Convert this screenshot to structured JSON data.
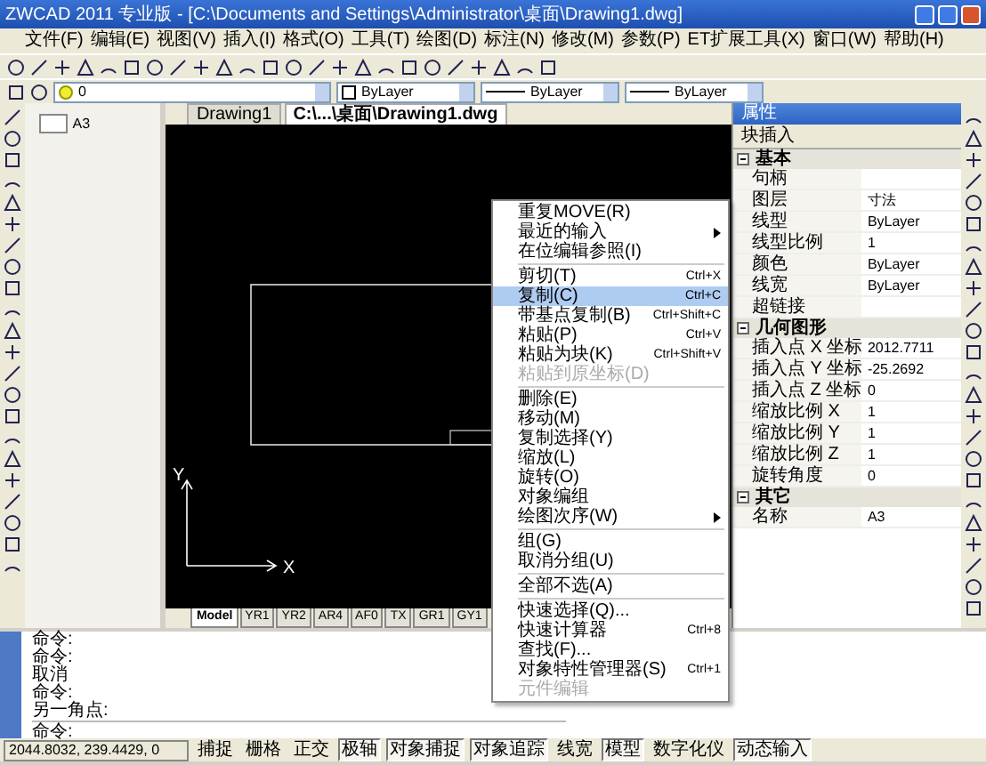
{
  "window": {
    "title": "ZWCAD 2011 专业版 - [C:\\Documents and Settings\\Administrator\\桌面\\Drawing1.dwg]"
  },
  "menu": [
    {
      "label": "文件(F)"
    },
    {
      "label": "编辑(E)"
    },
    {
      "label": "视图(V)"
    },
    {
      "label": "插入(I)"
    },
    {
      "label": "格式(O)"
    },
    {
      "label": "工具(T)"
    },
    {
      "label": "绘图(D)"
    },
    {
      "label": "标注(N)"
    },
    {
      "label": "修改(M)"
    },
    {
      "label": "参数(P)"
    },
    {
      "label": "ET扩展工具(X)"
    },
    {
      "label": "窗口(W)"
    },
    {
      "label": "帮助(H)"
    }
  ],
  "toolbar": {
    "layer": "0",
    "combos": [
      {
        "kind": "swatch",
        "value": "ByLayer"
      },
      {
        "kind": "line",
        "value": "ByLayer"
      },
      {
        "kind": "line",
        "value": "ByLayer"
      }
    ]
  },
  "block_preview": {
    "label": "A3"
  },
  "doc_tabs": [
    {
      "label": "Drawing1",
      "selected": false
    },
    {
      "label": "C:\\...\\桌面\\Drawing1.dwg",
      "selected": true
    }
  ],
  "canvas": {
    "x_axis": "X",
    "y_axis": "Y"
  },
  "layout_tabs": [
    {
      "label": "Model",
      "selected": true
    },
    {
      "label": "YR1",
      "selected": false
    },
    {
      "label": "YR2",
      "selected": false
    },
    {
      "label": "AR4",
      "selected": false
    },
    {
      "label": "AF0",
      "selected": false
    },
    {
      "label": "TX",
      "selected": false
    },
    {
      "label": "GR1",
      "selected": false
    },
    {
      "label": "GY1",
      "selected": false
    }
  ],
  "properties": {
    "title": "属性",
    "object": "块插入",
    "sections": [
      {
        "name": "基本",
        "expanded": true,
        "rows": [
          {
            "label": "句柄"
          },
          {
            "label": "图层",
            "value": "寸法"
          },
          {
            "label": "线型",
            "value": "ByLayer"
          },
          {
            "label": "线型比例",
            "value": "1"
          },
          {
            "label": "颜色",
            "value": "ByLayer"
          },
          {
            "label": "线宽",
            "value": "ByLayer"
          },
          {
            "label": "超链接"
          }
        ]
      },
      {
        "name": "几何图形",
        "expanded": true,
        "rows": [
          {
            "label": "插入点 X 坐标",
            "value": "2012.7711"
          },
          {
            "label": "插入点 Y 坐标",
            "value": "-25.2692"
          },
          {
            "label": "插入点 Z 坐标",
            "value": "0"
          },
          {
            "label": "缩放比例 X",
            "value": "1"
          },
          {
            "label": "缩放比例 Y",
            "value": "1"
          },
          {
            "label": "缩放比例 Z",
            "value": "1"
          },
          {
            "label": "旋转角度",
            "value": "0"
          }
        ]
      },
      {
        "name": "其它",
        "expanded": true,
        "rows": [
          {
            "label": "名称",
            "value": "A3"
          }
        ]
      }
    ]
  },
  "context_menu": [
    {
      "kind": "item",
      "label": "重复MOVE(R)",
      "selected": false,
      "disabled": false
    },
    {
      "kind": "item",
      "label": "最近的输入",
      "submenu": true,
      "selected": false,
      "disabled": false
    },
    {
      "kind": "item",
      "label": "在位编辑参照(I)",
      "selected": false,
      "disabled": false
    },
    {
      "kind": "separator"
    },
    {
      "kind": "item",
      "label": "剪切(T)",
      "shortcut": "Ctrl+X",
      "selected": false,
      "disabled": false
    },
    {
      "kind": "item",
      "label": "复制(C)",
      "shortcut": "Ctrl+C",
      "selected": true,
      "disabled": false
    },
    {
      "kind": "item",
      "label": "带基点复制(B)",
      "shortcut": "Ctrl+Shift+C",
      "selected": false,
      "disabled": false
    },
    {
      "kind": "item",
      "label": "粘贴(P)",
      "shortcut": "Ctrl+V",
      "selected": false,
      "disabled": false
    },
    {
      "kind": "item",
      "label": "粘贴为块(K)",
      "shortcut": "Ctrl+Shift+V",
      "selected": false,
      "disabled": false
    },
    {
      "kind": "item",
      "label": "粘贴到原坐标(D)",
      "selected": false,
      "disabled": true
    },
    {
      "kind": "separator"
    },
    {
      "kind": "item",
      "label": "删除(E)",
      "selected": false,
      "disabled": false
    },
    {
      "kind": "item",
      "label": "移动(M)",
      "selected": false,
      "disabled": false
    },
    {
      "kind": "item",
      "label": "复制选择(Y)",
      "selected": false,
      "disabled": false
    },
    {
      "kind": "item",
      "label": "缩放(L)",
      "selected": false,
      "disabled": false
    },
    {
      "kind": "item",
      "label": "旋转(O)",
      "selected": false,
      "disabled": false
    },
    {
      "kind": "item",
      "label": "对象编组",
      "selected": false,
      "disabled": false
    },
    {
      "kind": "item",
      "label": "绘图次序(W)",
      "submenu": true,
      "selected": false,
      "disabled": false
    },
    {
      "kind": "separator"
    },
    {
      "kind": "item",
      "label": "组(G)",
      "selected": false,
      "disabled": false
    },
    {
      "kind": "item",
      "label": "取消分组(U)",
      "selected": false,
      "disabled": false
    },
    {
      "kind": "separator"
    },
    {
      "kind": "item",
      "label": "全部不选(A)",
      "selected": false,
      "disabled": false
    },
    {
      "kind": "separator"
    },
    {
      "kind": "item",
      "label": "快速选择(Q)...",
      "selected": false,
      "disabled": false
    },
    {
      "kind": "item",
      "label": "快速计算器",
      "shortcut": "Ctrl+8",
      "selected": false,
      "disabled": false
    },
    {
      "kind": "item",
      "label": "查找(F)...",
      "selected": false,
      "disabled": false
    },
    {
      "kind": "item",
      "label": "对象特性管理器(S)",
      "shortcut": "Ctrl+1",
      "selected": false,
      "disabled": false
    },
    {
      "kind": "item",
      "label": "元件编辑",
      "selected": false,
      "disabled": true
    }
  ],
  "command": {
    "history": [
      "命令:",
      "命令:",
      "取消",
      "命令:",
      "另一角点:"
    ],
    "prompt": "命令:"
  },
  "status": {
    "coords": "2044.8032, 239.4429, 0",
    "toggles": [
      {
        "label": "捕捉",
        "on": false
      },
      {
        "label": "栅格",
        "on": false
      },
      {
        "label": "正交",
        "on": false
      },
      {
        "label": "极轴",
        "on": true
      },
      {
        "label": "对象捕捉",
        "on": true
      },
      {
        "label": "对象追踪",
        "on": true
      },
      {
        "label": "线宽",
        "on": false
      },
      {
        "label": "模型",
        "on": true
      },
      {
        "label": "数字化仪",
        "on": false
      },
      {
        "label": "动态输入",
        "on": true
      }
    ]
  }
}
